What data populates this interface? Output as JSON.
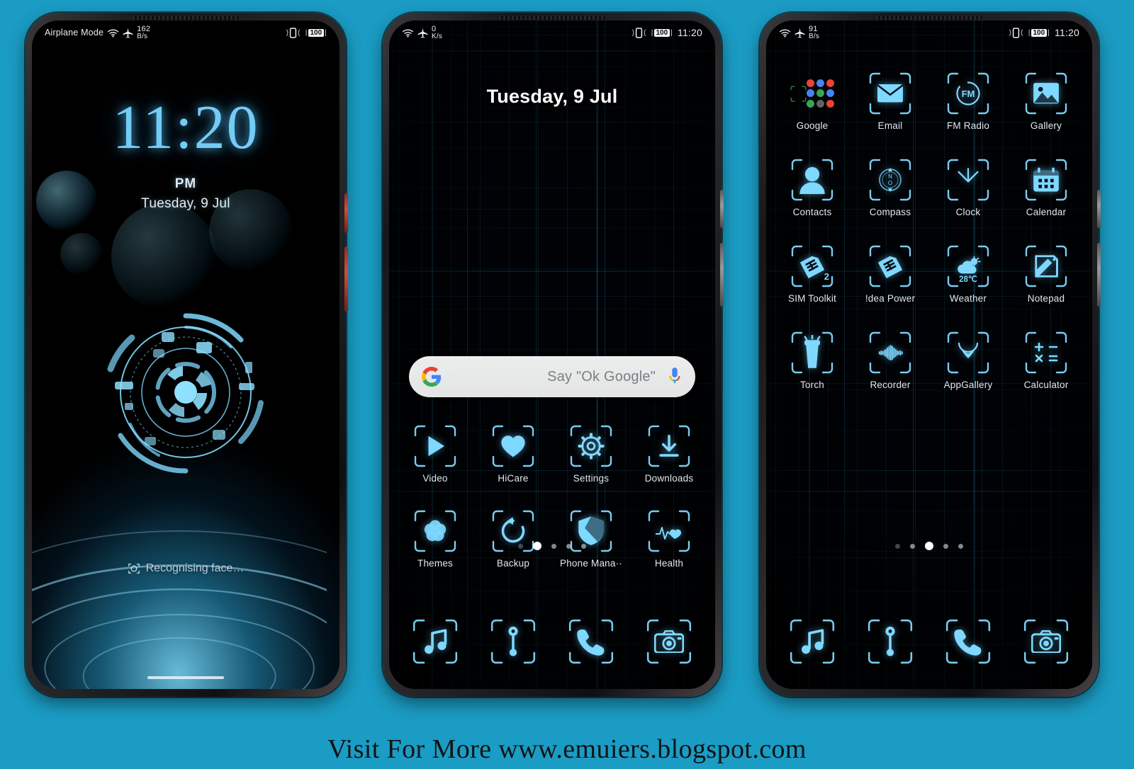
{
  "page": {
    "background_color": "#1b9cc4",
    "footer_text": "Visit For More www.emuiers.blogspot.com"
  },
  "theme": {
    "accent": "#6fd2f7",
    "icon_glow": "#7fd8ff",
    "label_color": "#dfeaf1",
    "screen_bg": "#000206"
  },
  "phone1": {
    "name": "lock-screen",
    "statusbar": {
      "airplane_label": "Airplane Mode",
      "wifi_icon": "wifi-icon",
      "airplane_icon": "airplane-icon",
      "net_speed_value": "162",
      "net_speed_unit": "B/s",
      "vibrate_icon": "vibrate-icon",
      "battery_percent": "100"
    },
    "clock": {
      "time": "11:20",
      "ampm": "PM",
      "date": "Tuesday, 9 Jul"
    },
    "hud_icon": "hud-circle-graphic",
    "face_unlock": {
      "icon": "face-unlock-icon",
      "text": "Recognising face…"
    },
    "home_indicator": "home-bar"
  },
  "phone2": {
    "name": "home-screen-page-2",
    "statusbar": {
      "wifi_icon": "wifi-icon",
      "airplane_icon": "airplane-icon",
      "net_speed_value": "0",
      "net_speed_unit": "K/s",
      "vibrate_icon": "vibrate-icon",
      "battery_percent": "100",
      "clock": "11:20"
    },
    "date_widget": "Tuesday, 9 Jul",
    "search": {
      "logo_icon": "google-g-icon",
      "placeholder": "Say \"Ok Google\"",
      "mic_icon": "microphone-icon"
    },
    "apps": [
      {
        "label": "Video",
        "icon": "play-icon"
      },
      {
        "label": "HiCare",
        "icon": "heart-icon"
      },
      {
        "label": "Settings",
        "icon": "gear-icon"
      },
      {
        "label": "Downloads",
        "icon": "download-arrow-icon"
      },
      {
        "label": "Themes",
        "icon": "flower-pinwheel-icon"
      },
      {
        "label": "Backup",
        "icon": "circular-arrow-icon"
      },
      {
        "label": "Phone Mana··",
        "icon": "shield-icon"
      },
      {
        "label": "Health",
        "icon": "heart-pulse-icon"
      }
    ],
    "page_dots": {
      "count": 5,
      "active_index": 1
    },
    "dock": [
      {
        "label": "Music",
        "icon": "music-note-icon"
      },
      {
        "label": "Browser",
        "icon": "browser-compass-icon"
      },
      {
        "label": "Phone",
        "icon": "phone-handset-icon"
      },
      {
        "label": "Camera",
        "icon": "camera-icon"
      }
    ]
  },
  "phone3": {
    "name": "home-screen-page-3",
    "statusbar": {
      "wifi_icon": "wifi-icon",
      "airplane_icon": "airplane-icon",
      "net_speed_value": "91",
      "net_speed_unit": "B/s",
      "vibrate_icon": "vibrate-icon",
      "battery_percent": "100",
      "clock": "11:20"
    },
    "apps": [
      {
        "label": "Google",
        "icon": "google-folder",
        "is_folder": true
      },
      {
        "label": "Email",
        "icon": "envelope-icon"
      },
      {
        "label": "FM Radio",
        "icon": "fm-radio-icon",
        "badge": "FM"
      },
      {
        "label": "Gallery",
        "icon": "picture-icon"
      },
      {
        "label": "Contacts",
        "icon": "person-icon"
      },
      {
        "label": "Compass",
        "icon": "compass-icon",
        "badge": "N"
      },
      {
        "label": "Clock",
        "icon": "clock-hands-icon"
      },
      {
        "label": "Calendar",
        "icon": "calendar-icon"
      },
      {
        "label": "SIM Toolkit",
        "icon": "sim-card-icon",
        "badge": "2"
      },
      {
        "label": "!dea Power",
        "icon": "sim-card-icon"
      },
      {
        "label": "Weather",
        "icon": "sun-cloud-icon",
        "badge": "28℃"
      },
      {
        "label": "Notepad",
        "icon": "note-pencil-icon"
      },
      {
        "label": "Torch",
        "icon": "flashlight-icon"
      },
      {
        "label": "Recorder",
        "icon": "waveform-icon"
      },
      {
        "label": "AppGallery",
        "icon": "huawei-flower-icon"
      },
      {
        "label": "Calculator",
        "icon": "calculator-symbols-icon"
      }
    ],
    "folder_colors": [
      "#ea4335",
      "#4285f4",
      "#ea4335",
      "#4285f4",
      "#34a853",
      "#4285f4",
      "#34a853",
      "#5f6368",
      "#ea4335"
    ],
    "page_dots": {
      "count": 5,
      "active_index": 2
    },
    "dock": [
      {
        "label": "Music",
        "icon": "music-note-icon"
      },
      {
        "label": "Browser",
        "icon": "browser-compass-icon"
      },
      {
        "label": "Phone",
        "icon": "phone-handset-icon"
      },
      {
        "label": "Camera",
        "icon": "camera-icon"
      }
    ]
  }
}
